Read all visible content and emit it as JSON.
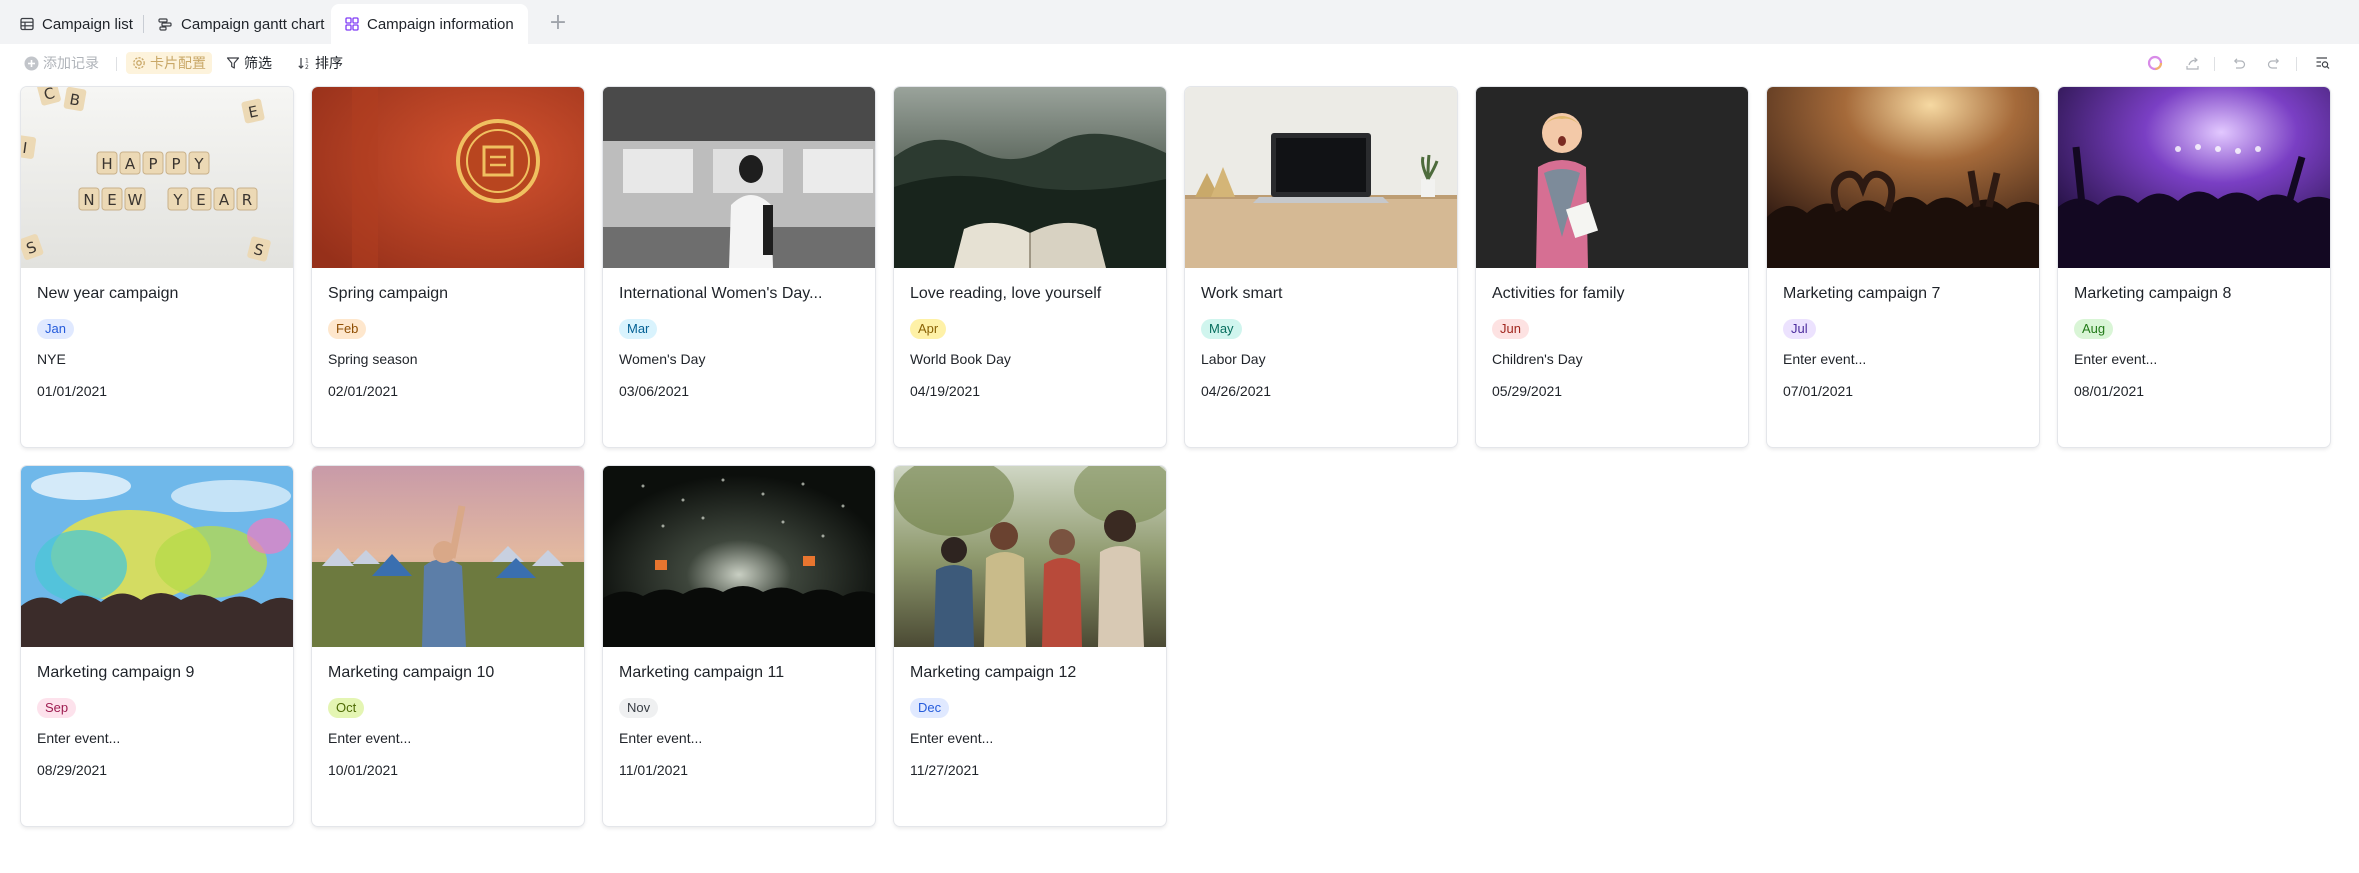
{
  "tabs": [
    {
      "label": "Campaign list",
      "icon": "table-icon"
    },
    {
      "label": "Campaign gantt chart",
      "icon": "gantt-icon"
    },
    {
      "label": "Campaign information",
      "icon": "gallery-icon",
      "active": true
    }
  ],
  "toolbar": {
    "add_record": "添加记录",
    "card_config": "卡片配置",
    "filter": "筛选",
    "sort": "排序"
  },
  "cards": [
    {
      "title": "New year campaign",
      "month": "Jan",
      "event": "NYE",
      "date": "01/01/2021",
      "image": "happy-new-year-letter-tiles",
      "tag_bg": "#e0e9ff",
      "tag_fg": "#245bdb"
    },
    {
      "title": "Spring campaign",
      "month": "Feb",
      "event": "Spring season",
      "date": "02/01/2021",
      "image": "red-chinese-emblem",
      "tag_bg": "#fee7cd",
      "tag_fg": "#8f4f04"
    },
    {
      "title": "International Women's Day...",
      "month": "Mar",
      "event": "Women's Day",
      "date": "03/06/2021",
      "image": "woman-at-train-bw",
      "tag_bg": "#d9f3fd",
      "tag_fg": "#036094"
    },
    {
      "title": "Love reading, love yourself",
      "month": "Apr",
      "event": "World Book Day",
      "date": "04/19/2021",
      "image": "open-book-forest",
      "tag_bg": "#fef1a7",
      "tag_fg": "#8a6205"
    },
    {
      "title": "Work smart",
      "month": "May",
      "event": "Labor Day",
      "date": "04/26/2021",
      "image": "laptop-on-desk",
      "tag_bg": "#d0f5ee",
      "tag_fg": "#076e5e"
    },
    {
      "title": "Activities for family",
      "month": "Jun",
      "event": "Children's Day",
      "date": "05/29/2021",
      "image": "surprised-child",
      "tag_bg": "#fde2e2",
      "tag_fg": "#a1271f"
    },
    {
      "title": "Marketing campaign 7",
      "month": "Jul",
      "event": "Enter event...",
      "date": "07/01/2021",
      "image": "concert-heart-hands",
      "tag_bg": "#ece2fe",
      "tag_fg": "#4c2d9e"
    },
    {
      "title": "Marketing campaign 8",
      "month": "Aug",
      "event": "Enter event...",
      "date": "08/01/2021",
      "image": "purple-concert-crowd",
      "tag_bg": "#d9f5d6",
      "tag_fg": "#237b19"
    },
    {
      "title": "Marketing campaign 9",
      "month": "Sep",
      "event": "Enter event...",
      "date": "08/29/2021",
      "image": "color-powder-festival",
      "tag_bg": "#fde2ec",
      "tag_fg": "#9e1d51"
    },
    {
      "title": "Marketing campaign 10",
      "month": "Oct",
      "event": "Enter event...",
      "date": "10/01/2021",
      "image": "festival-campsite",
      "tag_bg": "#e4f5b3",
      "tag_fg": "#4e6b04"
    },
    {
      "title": "Marketing campaign 11",
      "month": "Nov",
      "event": "Enter event...",
      "date": "11/01/2021",
      "image": "dark-concert-confetti",
      "tag_bg": "#eff0f1",
      "tag_fg": "#373c43"
    },
    {
      "title": "Marketing campaign 12",
      "month": "Dec",
      "event": "Enter event...",
      "date": "11/27/2021",
      "image": "outdoor-festival-friends",
      "tag_bg": "#e0e9ff",
      "tag_fg": "#245bdb"
    }
  ]
}
